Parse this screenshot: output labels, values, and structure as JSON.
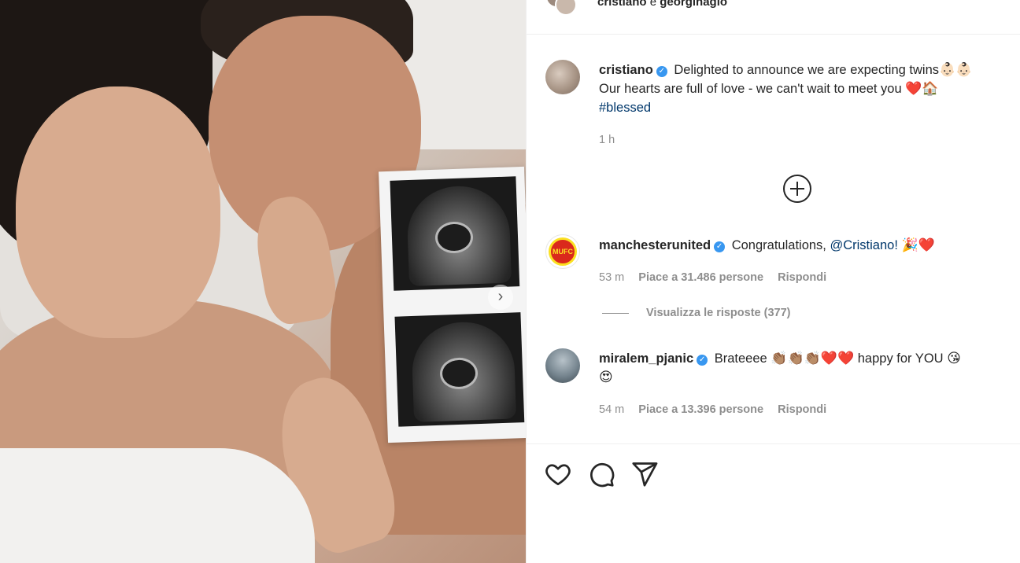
{
  "post": {
    "image_alt": "",
    "carousel_next_icon": "chevron-right-icon"
  },
  "header": {
    "title_user1": "cristiano",
    "title_joiner": " e ",
    "title_user2": "georginagio"
  },
  "caption": {
    "username": "cristiano",
    "line1": "Delighted to announce we are expecting twins",
    "line1_emojis": "👶🏻👶🏻",
    "line2": "Our hearts are full of love - we can't wait to meet you",
    "line2_emojis_heart": "❤️",
    "line2_emojis_home": "🏠",
    "hashtag": "#blessed",
    "time": "1 h"
  },
  "comments": [
    {
      "username": "manchesterunited",
      "text": "Congratulations,",
      "mention": "@Cristiano!",
      "emojis_party": "🎉",
      "emojis_heart": "❤️",
      "time": "53 m",
      "likes": "Piace a 31.486 persone",
      "reply": "Rispondi",
      "crest_text": "MUFC"
    },
    {
      "username": "miralem_pjanic",
      "text": "Brateeee",
      "emojis_clap": "👏🏽👏🏽👏🏽",
      "emojis_hearts": "❤️❤️",
      "text2": "happy for YOU",
      "emoji_kiss": "😘",
      "emoji_heart_eyes": "😍",
      "time": "54 m",
      "likes": "Piace a 13.396 persone",
      "reply": "Rispondi"
    }
  ],
  "replies_toggle": "Visualizza le risposte (377)",
  "icons": {
    "verified": "✓",
    "like": "heart-icon",
    "comment": "comment-icon",
    "share": "share-icon",
    "load_more": "plus-circle-icon"
  },
  "colors": {
    "verified_blue": "#3897f0",
    "link": "#00376b",
    "muted": "#8e8e8e",
    "text": "#262626"
  }
}
